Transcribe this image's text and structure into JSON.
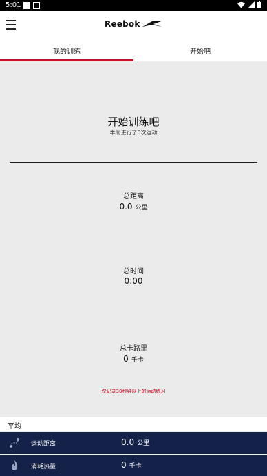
{
  "status": {
    "time": "5:01"
  },
  "header": {
    "brand": "Reebok"
  },
  "tabs": [
    {
      "label": "我的训练"
    },
    {
      "label": "开始吧"
    }
  ],
  "hero": {
    "title": "开始训练吧",
    "subtitle": "本周进行了0次运动"
  },
  "stats": {
    "distance": {
      "label": "总距离",
      "value": "0.0",
      "unit": "公里"
    },
    "time": {
      "label": "总时间",
      "value": "0:00"
    },
    "calories": {
      "label": "总卡路里",
      "value": "0",
      "unit": "千卡"
    }
  },
  "note": "仅记录30秒钟以上的运动练习",
  "average": {
    "title": "平均",
    "distance": {
      "label": "运动距离",
      "value": "0.0",
      "unit": "公里"
    },
    "calories": {
      "label": "消耗热量",
      "value": "0",
      "unit": "千卡"
    }
  },
  "colors": {
    "accent": "#c8102e",
    "navy": "#14224a",
    "note": "#d0021b"
  }
}
